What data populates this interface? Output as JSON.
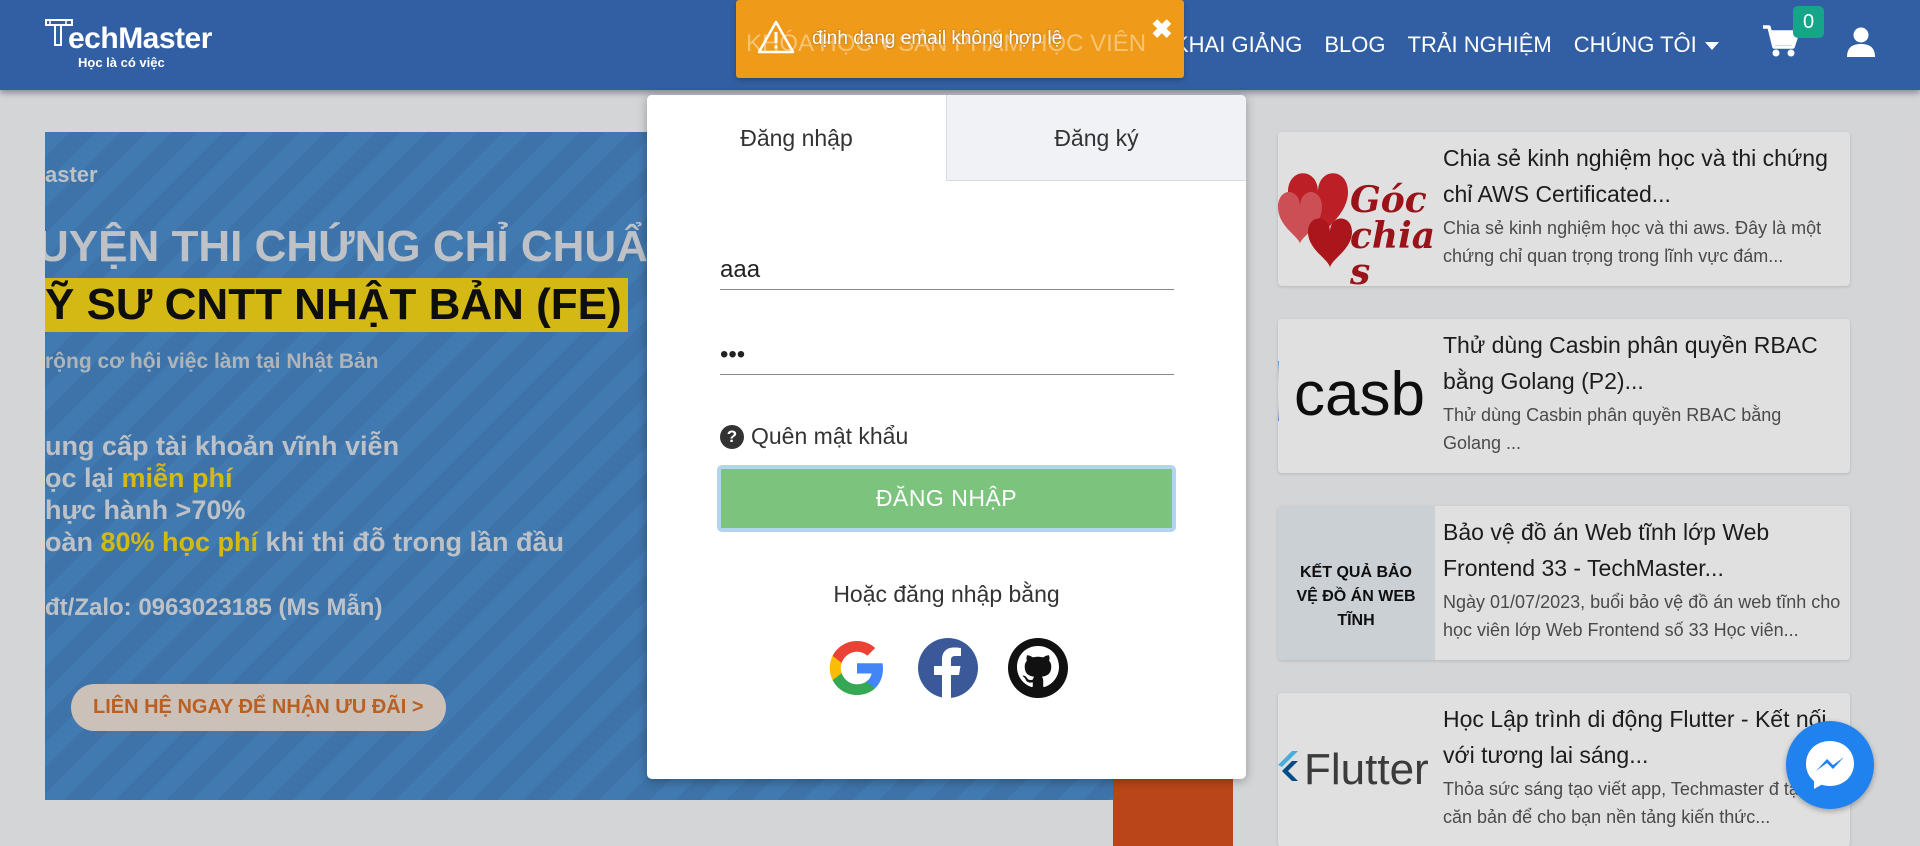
{
  "header": {
    "logo_text": "echMaster",
    "logo_tagline": "Học là có việc",
    "nav_faded": [
      "KHÓA HỌC",
      "SẢN PHẨM HỌC VIÊN"
    ],
    "nav": [
      "KHAI GIẢNG",
      "BLOG",
      "TRẢI NGHIỆM",
      "CHÚNG TÔI"
    ],
    "cart_count": "0",
    "icons": [
      "cart-icon",
      "user-icon"
    ]
  },
  "toast": {
    "message": "định dạng email không hợp lệ",
    "close": "✖",
    "behind_text": "KHÓA HỌC ▾  SẢN PHẨM HỌC VIÊN",
    "color": "#f09a1a"
  },
  "banner": {
    "brand": "aster",
    "line1": "UYỆN THI CHỨNG CHỈ CHUẨ",
    "line2": "Ỹ SƯ CNTT NHẬT BẢN (FE)",
    "subtitle": "rộng cơ hội việc làm tại Nhật Bản",
    "bullet1": "ung cấp tài khoản vĩnh viễn",
    "bullet2_pre": "ọc lại ",
    "bullet2_hl": "miễn phí",
    "bullet3": "hực hành >70%",
    "bullet4_pre": "oàn ",
    "bullet4_hl": "80% học phí",
    "bullet4_post": " khi thi đỗ trong lần đầu",
    "phone": "đt/Zalo: 0963023185 (Ms Mẫn)",
    "cta": "LIÊN HỆ NGAY ĐỂ NHẬN ƯU ĐÃI  >"
  },
  "modal": {
    "tab_login": "Đăng nhập",
    "tab_register": "Đăng ký",
    "email_value": "aaa",
    "password_value": "•••",
    "forgot": "Quên mật khẩu",
    "login_button": "ĐĂNG NHẬP",
    "or_text": "Hoặc đăng nhập bằng",
    "social": [
      "google-icon",
      "facebook-icon",
      "github-icon"
    ]
  },
  "posts": [
    {
      "title": "Chia sẻ kinh nghiệm học và thi chứng chỉ AWS Certificated...",
      "desc": "Chia sẻ kinh nghiệm học và thi aws. Đây là một chứng chỉ quan trọng trong lĩnh vực đám...",
      "thumb_text": "Góc chia s"
    },
    {
      "title": "Thử dùng Casbin phân quyền RBAC bằng Golang (P2)...",
      "desc": "Thử dùng Casbin phân quyền RBAC bằng Golang ...",
      "thumb_text": "casb"
    },
    {
      "title": "Bảo vệ đồ án Web tĩnh lớp Web Frontend 33 - TechMaster...",
      "desc": "Ngày 01/07/2023, buổi bảo vệ đồ án web tĩnh cho học viên lớp Web Frontend số 33 Học viên...",
      "thumb_text": "KẾT QUẢ BẢO VỆ ĐỒ ÁN WEB TĨNH"
    },
    {
      "title": "Học Lập trình di động Flutter - Kết nối với tương lai sáng...",
      "desc": "Thỏa sức sáng tạo viết app, Techmaster đ tạo từ căn bản để cho bạn nền tảng kiến thức...",
      "thumb_text": "Flutter"
    }
  ],
  "colors": {
    "header": "#325fa3",
    "login_button": "#7cc47e",
    "badge": "#17a589",
    "messenger": "#1f82ef"
  }
}
